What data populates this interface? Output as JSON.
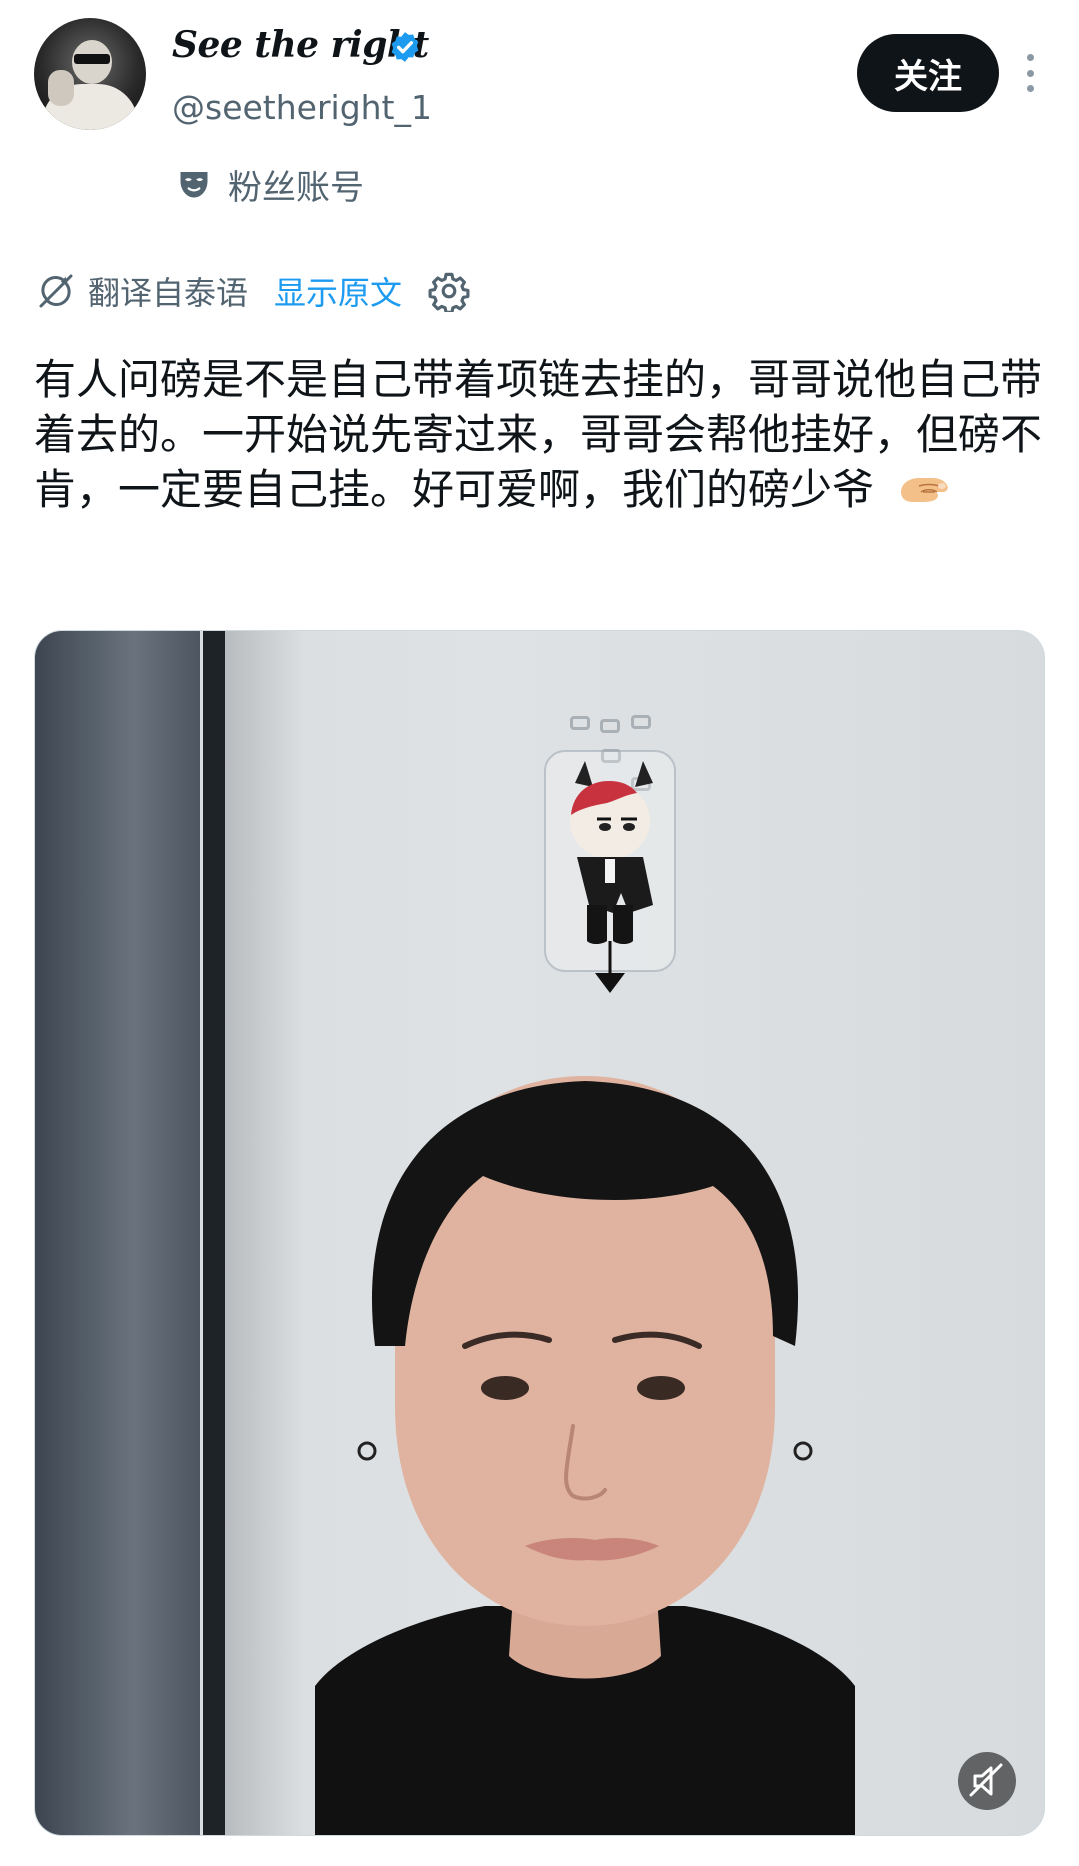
{
  "header": {
    "display_name": "See the right",
    "handle": "@seetheright_1",
    "account_label": "粉丝账号",
    "follow_label": "关注",
    "verified": true
  },
  "translation": {
    "translated_from": "翻译自泰语",
    "show_original": "显示原文"
  },
  "tweet": {
    "text": "有人问磅是不是自己带着项链去挂的，哥哥说他自己带着去的。一开始说先寄过来，哥哥会帮他挂好，但磅不肯，一定要自己挂。好可爱啊，我们的磅少爷",
    "emoji": "pinching-hand-emoji"
  },
  "media": {
    "type": "video",
    "muted": true
  },
  "colors": {
    "text_primary": "#0f1419",
    "text_secondary": "#536471",
    "link_blue": "#1d9bf0",
    "follow_button_bg": "#0f1419"
  },
  "icons": [
    "verified-badge-icon",
    "mask-icon",
    "translate-icon",
    "settings-icon",
    "more-icon",
    "muted-speaker-icon"
  ]
}
